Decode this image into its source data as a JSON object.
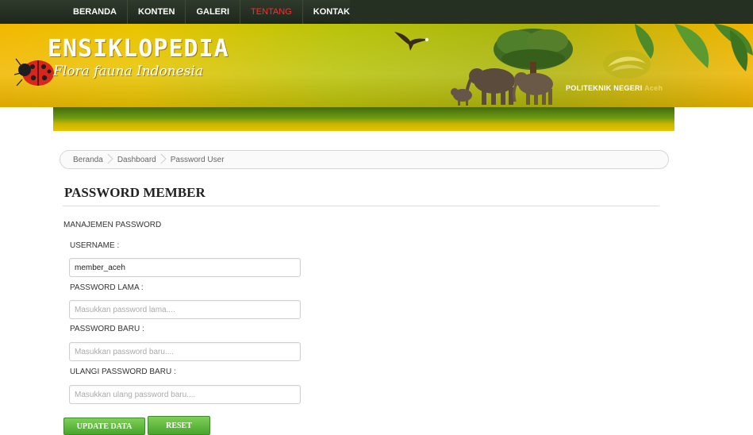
{
  "nav": {
    "items": [
      {
        "label": "BERANDA"
      },
      {
        "label": "KONTEN"
      },
      {
        "label": "GALERI"
      },
      {
        "label": "TENTANG"
      },
      {
        "label": "KONTAK"
      }
    ],
    "active_index": 3
  },
  "banner": {
    "title": "ENSIKLOPEDIA",
    "subtitle": "Flora fauna Indonesia",
    "institution": "POLITEKNIK NEGERI",
    "institution_suffix": "Aceh"
  },
  "breadcrumb": [
    {
      "label": "Beranda"
    },
    {
      "label": "Dashboard"
    },
    {
      "label": "Password User"
    }
  ],
  "page": {
    "title": "PASSWORD MEMBER",
    "section": "MANAJEMEN PASSWORD"
  },
  "form": {
    "username_label": "USERNAME :",
    "username_value": "member_aceh",
    "old_label": "PASSWORD LAMA :",
    "old_placeholder": "Masukkan password lama....",
    "new_label": "PASSWORD BARU :",
    "new_placeholder": "Masukkan password baru....",
    "repeat_label": "ULANGI PASSWORD BARU :",
    "repeat_placeholder": "Masukkan ulang password baru...."
  },
  "buttons": {
    "update": "UPDATE DATA",
    "reset": "RESET"
  },
  "colors": {
    "active_nav": "#ff2d2d",
    "button_green": "#48a52c",
    "banner_yellow": "#e9c400"
  }
}
